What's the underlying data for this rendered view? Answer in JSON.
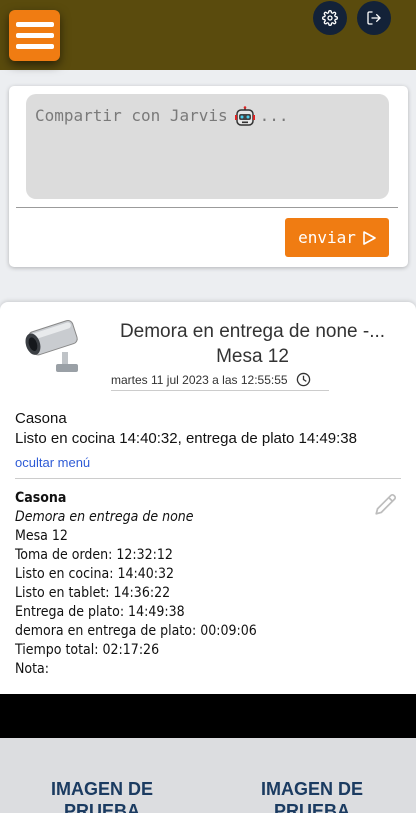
{
  "header": {
    "menu_icon": "hamburger-menu-icon",
    "settings_icon": "gear-icon",
    "logout_icon": "logout-icon",
    "bar_color": "#5a4b0d",
    "accent_color": "#f07c12"
  },
  "share": {
    "placeholder_prefix": "Compartir con Jarvis",
    "placeholder_suffix": "...",
    "robot_icon": "robot-icon",
    "send_label": "enviar",
    "send_icon": "send-arrow-icon"
  },
  "alert": {
    "title": "Demora en entrega de none -...",
    "subtitle": "Mesa 12",
    "date": "martes 11 jul 2023 a las 12:55:55",
    "clock_icon": "clock-icon",
    "camera_icon": "security-camera-icon",
    "summary_place": "Casona",
    "summary_text": "Listo en cocina 14:40:32, entrega de plato 14:49:38",
    "hide_menu_link": "ocultar menú",
    "detail": {
      "place": "Casona",
      "event": "Demora en entrega de none",
      "table": "Mesa 12",
      "order_time": "Toma de orden: 12:32:12",
      "kitchen_ready": "Listo en cocina: 14:40:32",
      "tablet_ready": "Listo en tablet: 14:36:22",
      "plate_delivery": "Entrega de plato: 14:49:38",
      "delivery_delay": "demora en entrega de plato: 00:09:06",
      "total_time": "Tiempo total: 02:17:26",
      "note": "Nota:"
    },
    "edit_icon": "pencil-icon"
  },
  "gallery": {
    "items": [
      {
        "label": "IMAGEN DE PRUEBA"
      },
      {
        "label": "IMAGEN DE PRUEBA"
      }
    ]
  }
}
